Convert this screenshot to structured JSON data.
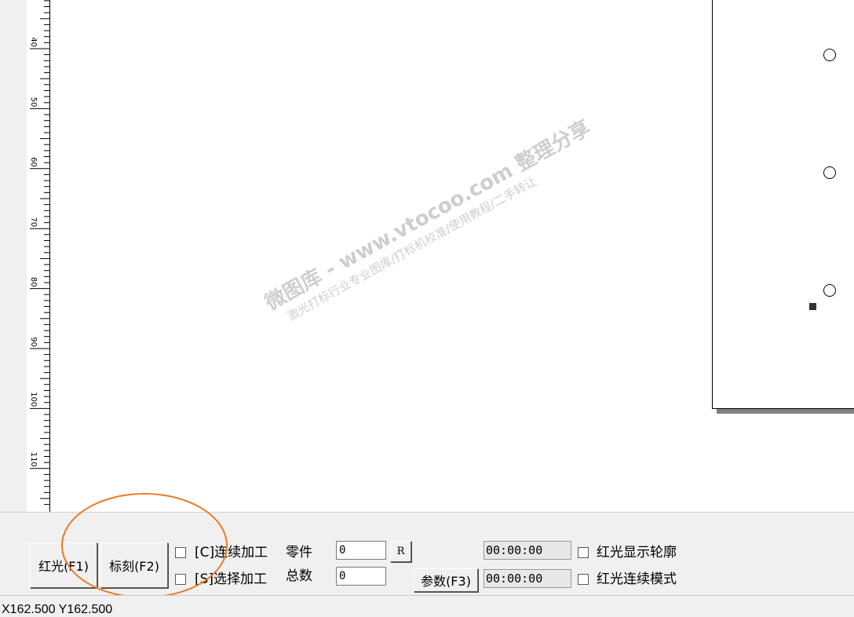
{
  "ruler": {
    "labels": [
      "40",
      "50",
      "60",
      "70",
      "80",
      "90",
      "100",
      "110"
    ]
  },
  "watermark": {
    "line1": "微图库 - www.vtocoo.com 整理分享",
    "line2": "激光打标行业专业图库/打标机校准/使用教程/二手转让"
  },
  "controls": {
    "red_light_label": "红光(F1)",
    "mark_label": "标刻(F2)",
    "continuous_label": "[C]连续加工",
    "select_label": "[S]选择加工",
    "parts_label": "零件",
    "parts_value": "0",
    "total_label": "总数",
    "total_value": "0",
    "reset_label": "R",
    "params_label": "参数(F3)",
    "time1": "00:00:00",
    "time2": "00:00:00",
    "show_outline_label": "红光显示轮廓",
    "red_continuous_label": "红光连续模式"
  },
  "status": {
    "coords": "X162.500 Y162.500"
  },
  "colors": {
    "annotation": "#ec7a22"
  }
}
